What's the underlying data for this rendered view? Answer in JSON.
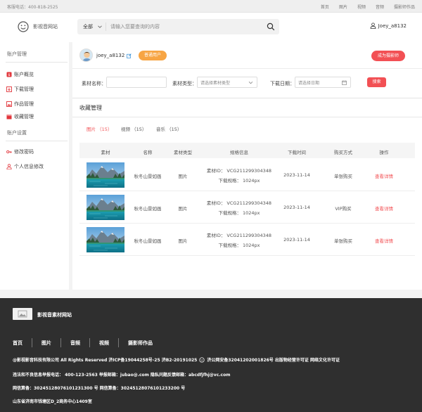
{
  "topbar": {
    "hotline": "客服电话：400-818-2525",
    "links": [
      "首页",
      "图片",
      "视频",
      "音频",
      "摄影师作品"
    ]
  },
  "header": {
    "logo_text": "影视音网站",
    "search_category": "全部",
    "search_placeholder": "请输入您要查询的内容",
    "username": "Joey_a8132"
  },
  "sidebar": {
    "section1": "账户管理",
    "items1": [
      "账户概览",
      "下载管理",
      "作品管理",
      "收藏管理"
    ],
    "section2": "账户设置",
    "items2": [
      "修改密码",
      "个人信息修改"
    ]
  },
  "profile": {
    "username": "joey_a8132",
    "badge": "普通用户",
    "cta": "成为摄影师"
  },
  "filters": {
    "name_label": "素材名称：",
    "name_value": "",
    "type_label": "素材类型：",
    "type_placeholder": "请选择素材类型",
    "date_label": "下载日期：",
    "date_placeholder": "请选择日期",
    "search_button": "搜索"
  },
  "collection": {
    "title": "收藏管理",
    "tabs": [
      "图片 （15）",
      "视频 （15）",
      "音乐 （15）"
    ],
    "active_tab": 0,
    "headers": [
      "素材",
      "名称",
      "素材类型",
      "规格信息",
      "下载时间",
      "购买方式",
      "操作"
    ],
    "rows": [
      {
        "name": "秋冬山景如画",
        "type": "图片",
        "spec_id": "素材ID： VCG211299304348",
        "spec_size": "下载规格： 1024px",
        "time": "2023-11-14",
        "purchase": "单张购买",
        "action": "查看详情"
      },
      {
        "name": "秋冬山景如画",
        "type": "图片",
        "spec_id": "素材ID： VCG211299304348",
        "spec_size": "下载规格： 1024px",
        "time": "2023-11-14",
        "purchase": "VIP购买",
        "action": "查看详情"
      },
      {
        "name": "秋冬山景如画",
        "type": "图片",
        "spec_id": "素材ID： VCG211299304348",
        "spec_size": "下载规格： 1024px",
        "time": "2023-11-14",
        "purchase": "单张购买",
        "action": "查看详情"
      }
    ]
  },
  "footer": {
    "site_name": "影视音素材网站",
    "nav": [
      "首页",
      "图片",
      "音频",
      "视频",
      "摄影师作品"
    ],
    "line1_a": "@影视影音科技有限公司  All Rights  Reserved  济ICP备19044258号-25  济B2-20191025",
    "line1_b": "济公网安备32041202001826号  出版物经营许可证  网络文化许可证",
    "line2": "违法和不良信息举报电话： 400-123-2563  举报邮箱：jubao@.com  隐私问题反馈邮箱：abcdfjfhj@vc.com",
    "line3": "网信算备：30245128076101231300 号  网信算备：30245128076101233200 号",
    "line4": "山东省济南市钱塘区D_2商务中心1409室"
  },
  "colors": {
    "accent": "#f25054",
    "badge": "#f7a544",
    "footer_bg": "#2f2f2f"
  }
}
